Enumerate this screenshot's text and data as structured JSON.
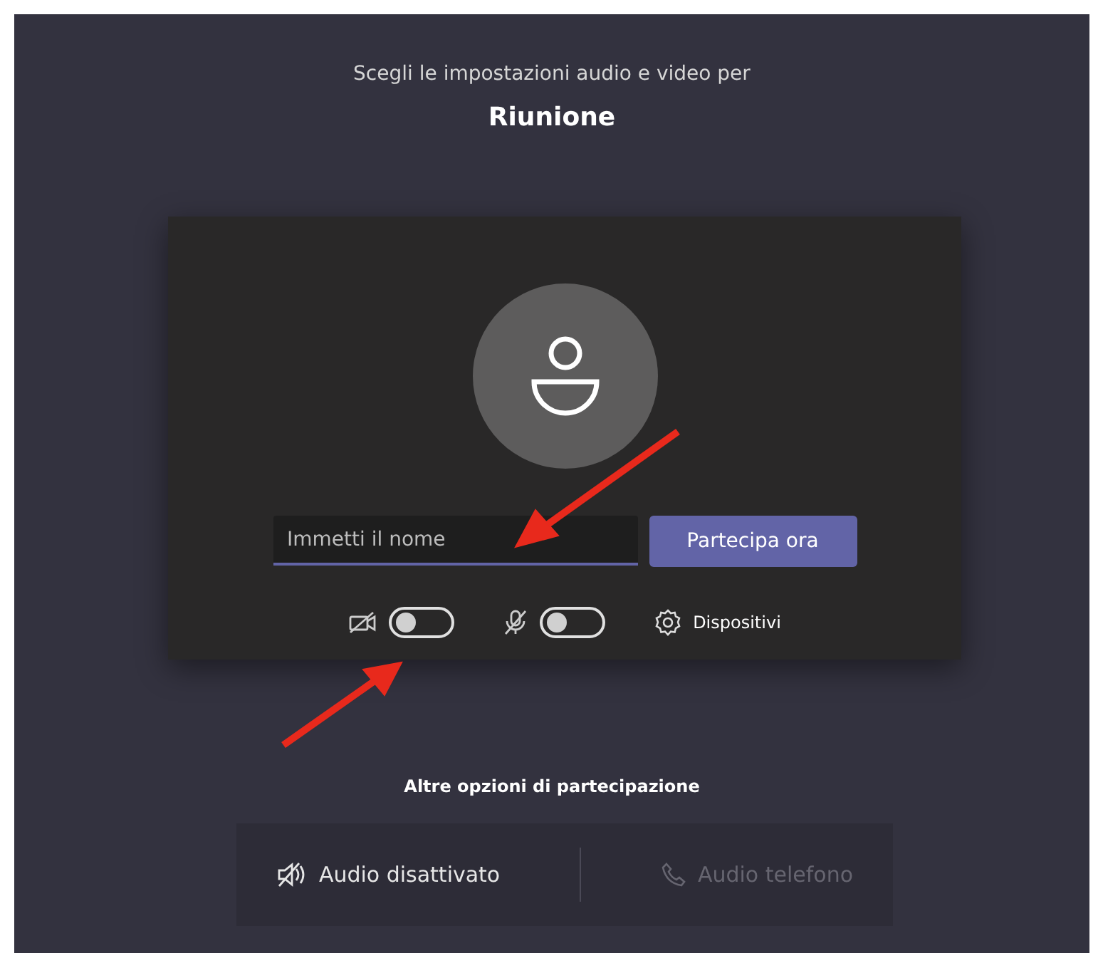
{
  "heading": "Scegli le impostazioni audio e video per",
  "meeting_title": "Riunione",
  "name_field": {
    "placeholder": "Immetti il nome"
  },
  "join_button": "Partecipa ora",
  "toggles": [
    {
      "kind": "video",
      "on": false
    },
    {
      "kind": "audio",
      "on": false
    }
  ],
  "devices_button": "Dispositivi",
  "more_options_title": "Altre opzioni di partecipazione",
  "options": [
    {
      "kind": "audio-off",
      "label": "Audio disattivato",
      "disabled": false
    },
    {
      "kind": "phone",
      "label": "Audio telefono",
      "disabled": true
    }
  ]
}
